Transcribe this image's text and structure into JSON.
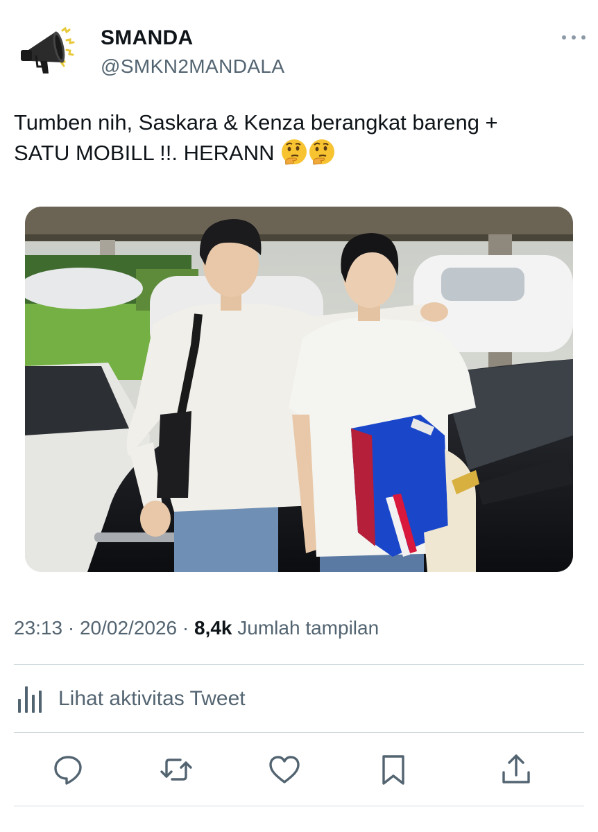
{
  "tweet": {
    "author": {
      "display_name": "SMANDA",
      "handle": "@SMKN2MANDALA",
      "avatar_icon": "megaphone-icon"
    },
    "text_line1": "Tumben nih, Saskara & Kenza berangkat bareng +",
    "text_line2": "SATU MOBILL !!. HERANN",
    "text_emojis": [
      "thinking-face-icon",
      "thinking-face-icon"
    ],
    "media_description_icon": "photo",
    "time": "23:13",
    "separator": "·",
    "date": "20/02/2026",
    "views_count": "8,4k",
    "views_label": "Jumlah tampilan"
  },
  "activity": {
    "label": "Lihat aktivitas Tweet",
    "icon": "bar-chart-icon"
  },
  "actions": [
    {
      "name": "reply",
      "icon": "speech-bubble-icon"
    },
    {
      "name": "retweet",
      "icon": "retweet-icon"
    },
    {
      "name": "like",
      "icon": "heart-icon"
    },
    {
      "name": "bookmark",
      "icon": "bookmark-icon"
    },
    {
      "name": "share",
      "icon": "share-icon"
    }
  ],
  "colors": {
    "text_primary": "#0f1419",
    "text_secondary": "#536471",
    "divider": "#cfd9de"
  }
}
